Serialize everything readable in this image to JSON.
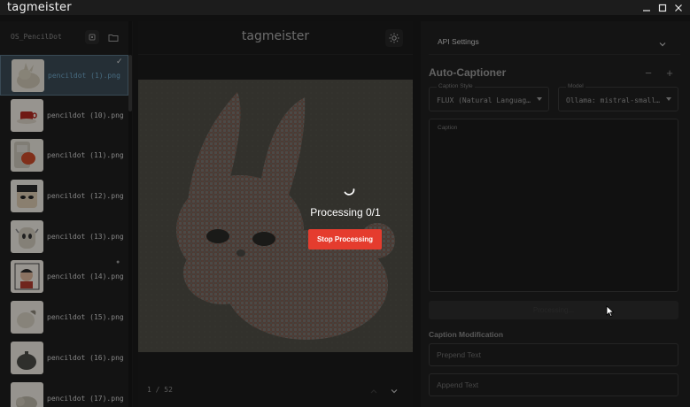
{
  "window": {
    "title": "tagmeister"
  },
  "sidebar": {
    "folder_name": "OS_PencilDot",
    "files": [
      {
        "name": "pencildot (1).png",
        "selected": true
      },
      {
        "name": "pencildot (10).png",
        "selected": false
      },
      {
        "name": "pencildot (11).png",
        "selected": false
      },
      {
        "name": "pencildot (12).png",
        "selected": false
      },
      {
        "name": "pencildot (13).png",
        "selected": false
      },
      {
        "name": "pencildot (14).png",
        "selected": false
      },
      {
        "name": "pencildot (15).png",
        "selected": false
      },
      {
        "name": "pencildot (16).png",
        "selected": false
      },
      {
        "name": "pencildot (17).png",
        "selected": false
      }
    ]
  },
  "center": {
    "logo": "tagmeister",
    "page_indicator": "1 / 52"
  },
  "overlay": {
    "status": "Processing 0/1",
    "stop_label": "Stop Processing",
    "stop_color": "#e53c2e"
  },
  "right": {
    "api_settings_label": "API Settings",
    "section_title": "Auto-Captioner",
    "caption_style": {
      "label": "Caption Style",
      "value": "FLUX (Natural Languag…"
    },
    "model": {
      "label": "Model",
      "value": "Ollama: mistral-small…"
    },
    "caption_label": "Caption",
    "process_button_label": "Processing...",
    "caption_modification_title": "Caption Modification",
    "prepend_placeholder": "Prepend Text",
    "append_placeholder": "Append Text"
  }
}
